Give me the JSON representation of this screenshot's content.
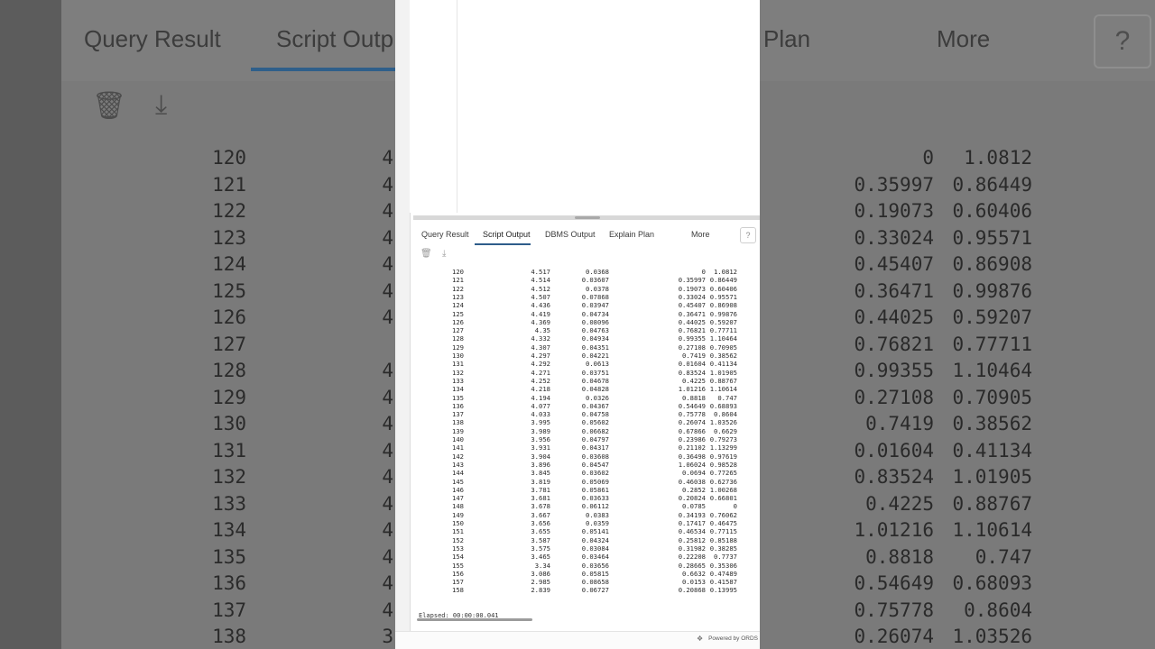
{
  "tabs": {
    "query_result": "Query Result",
    "script_output": "Script Output",
    "dbms_output": "DBMS Output",
    "explain_plan": "Explain Plan",
    "more": "More",
    "help": "?"
  },
  "toolbar": {
    "clear_icon": "trash-icon",
    "download_icon": "download-icon"
  },
  "background": {
    "tabs": [
      "Query Result",
      "Script Outp",
      "Plan",
      "More"
    ],
    "rows": [
      [
        "120",
        "4",
        "0",
        "1.0812"
      ],
      [
        "121",
        "4",
        "0.35997",
        "0.86449"
      ],
      [
        "122",
        "4",
        "0.19073",
        "0.60406"
      ],
      [
        "123",
        "4",
        "0.33024",
        "0.95571"
      ],
      [
        "124",
        "4",
        "0.45407",
        "0.86908"
      ],
      [
        "125",
        "4",
        "0.36471",
        "0.99876"
      ],
      [
        "126",
        "4",
        "0.44025",
        "0.59207"
      ],
      [
        "127",
        "",
        "0.76821",
        "0.77711"
      ],
      [
        "128",
        "4",
        "0.99355",
        "1.10464"
      ],
      [
        "129",
        "4",
        "0.27108",
        "0.70905"
      ],
      [
        "130",
        "4",
        "0.7419",
        "0.38562"
      ],
      [
        "131",
        "4",
        "0.01604",
        "0.41134"
      ],
      [
        "132",
        "4",
        "0.83524",
        "1.01905"
      ],
      [
        "133",
        "4",
        "0.4225",
        "0.88767"
      ],
      [
        "134",
        "4",
        "1.01216",
        "1.10614"
      ],
      [
        "135",
        "4",
        "0.8818",
        "0.747"
      ],
      [
        "136",
        "4",
        "0.54649",
        "0.68093"
      ],
      [
        "137",
        "4",
        "0.75778",
        "0.8604"
      ],
      [
        "138",
        "3",
        "0.26074",
        "1.03526"
      ]
    ]
  },
  "output": {
    "rows": [
      [
        "120",
        "4.517",
        "0.0368",
        "0",
        "1.0812"
      ],
      [
        "121",
        "4.514",
        "0.03607",
        "0.35997",
        "0.86449"
      ],
      [
        "122",
        "4.512",
        "0.0378",
        "0.19073",
        "0.60406"
      ],
      [
        "123",
        "4.507",
        "0.07868",
        "0.33024",
        "0.95571"
      ],
      [
        "124",
        "4.436",
        "0.03947",
        "0.45407",
        "0.86908"
      ],
      [
        "125",
        "4.419",
        "0.04734",
        "0.36471",
        "0.99876"
      ],
      [
        "126",
        "4.369",
        "0.08096",
        "0.44025",
        "0.59207"
      ],
      [
        "127",
        "4.35",
        "0.04763",
        "0.76821",
        "0.77711"
      ],
      [
        "128",
        "4.332",
        "0.04934",
        "0.99355",
        "1.10464"
      ],
      [
        "129",
        "4.307",
        "0.04351",
        "0.27108",
        "0.70905"
      ],
      [
        "130",
        "4.297",
        "0.04221",
        "0.7419",
        "0.38562"
      ],
      [
        "131",
        "4.292",
        "0.0613",
        "0.01604",
        "0.41134"
      ],
      [
        "132",
        "4.271",
        "0.03751",
        "0.83524",
        "1.01905"
      ],
      [
        "133",
        "4.252",
        "0.04678",
        "0.4225",
        "0.88767"
      ],
      [
        "134",
        "4.218",
        "0.04828",
        "1.01216",
        "1.10614"
      ],
      [
        "135",
        "4.194",
        "0.0326",
        "0.8818",
        "0.747"
      ],
      [
        "136",
        "4.077",
        "0.04367",
        "0.54649",
        "0.68893"
      ],
      [
        "137",
        "4.033",
        "0.04758",
        "0.75778",
        "0.8604"
      ],
      [
        "138",
        "3.995",
        "0.05602",
        "0.26074",
        "1.03526"
      ],
      [
        "139",
        "3.989",
        "0.06682",
        "0.67866",
        "0.6629"
      ],
      [
        "140",
        "3.956",
        "0.04797",
        "0.23986",
        "0.79273"
      ],
      [
        "141",
        "3.931",
        "0.04317",
        "0.21102",
        "1.13299"
      ],
      [
        "142",
        "3.904",
        "0.03608",
        "0.36498",
        "0.97619"
      ],
      [
        "143",
        "3.896",
        "0.04547",
        "1.06024",
        "0.98528"
      ],
      [
        "144",
        "3.845",
        "0.03602",
        "0.0694",
        "0.77265"
      ],
      [
        "145",
        "3.819",
        "0.05069",
        "0.46038",
        "0.62736"
      ],
      [
        "146",
        "3.781",
        "0.05861",
        "0.2852",
        "1.00268"
      ],
      [
        "147",
        "3.681",
        "0.03633",
        "0.20824",
        "0.66801"
      ],
      [
        "148",
        "3.678",
        "0.06112",
        "0.0785",
        "0"
      ],
      [
        "149",
        "3.667",
        "0.0383",
        "0.34193",
        "0.76062"
      ],
      [
        "150",
        "3.656",
        "0.0359",
        "0.17417",
        "0.46475"
      ],
      [
        "151",
        "3.655",
        "0.05141",
        "0.46534",
        "0.77115"
      ],
      [
        "152",
        "3.587",
        "0.04324",
        "0.25812",
        "0.85188"
      ],
      [
        "153",
        "3.575",
        "0.03084",
        "0.31982",
        "0.38285"
      ],
      [
        "154",
        "3.465",
        "0.03464",
        "0.22208",
        "0.7737"
      ],
      [
        "155",
        "3.34",
        "0.03656",
        "0.28665",
        "0.35306"
      ],
      [
        "156",
        "3.086",
        "0.05815",
        "0.6632",
        "0.47489"
      ],
      [
        "157",
        "2.985",
        "0.08658",
        "0.0153",
        "0.41587"
      ],
      [
        "158",
        "2.839",
        "0.06727",
        "0.20868",
        "0.13995"
      ]
    ],
    "elapsed": "Elapsed: 00:00:00.041"
  },
  "footer": {
    "powered": "Powered by ORDS"
  }
}
